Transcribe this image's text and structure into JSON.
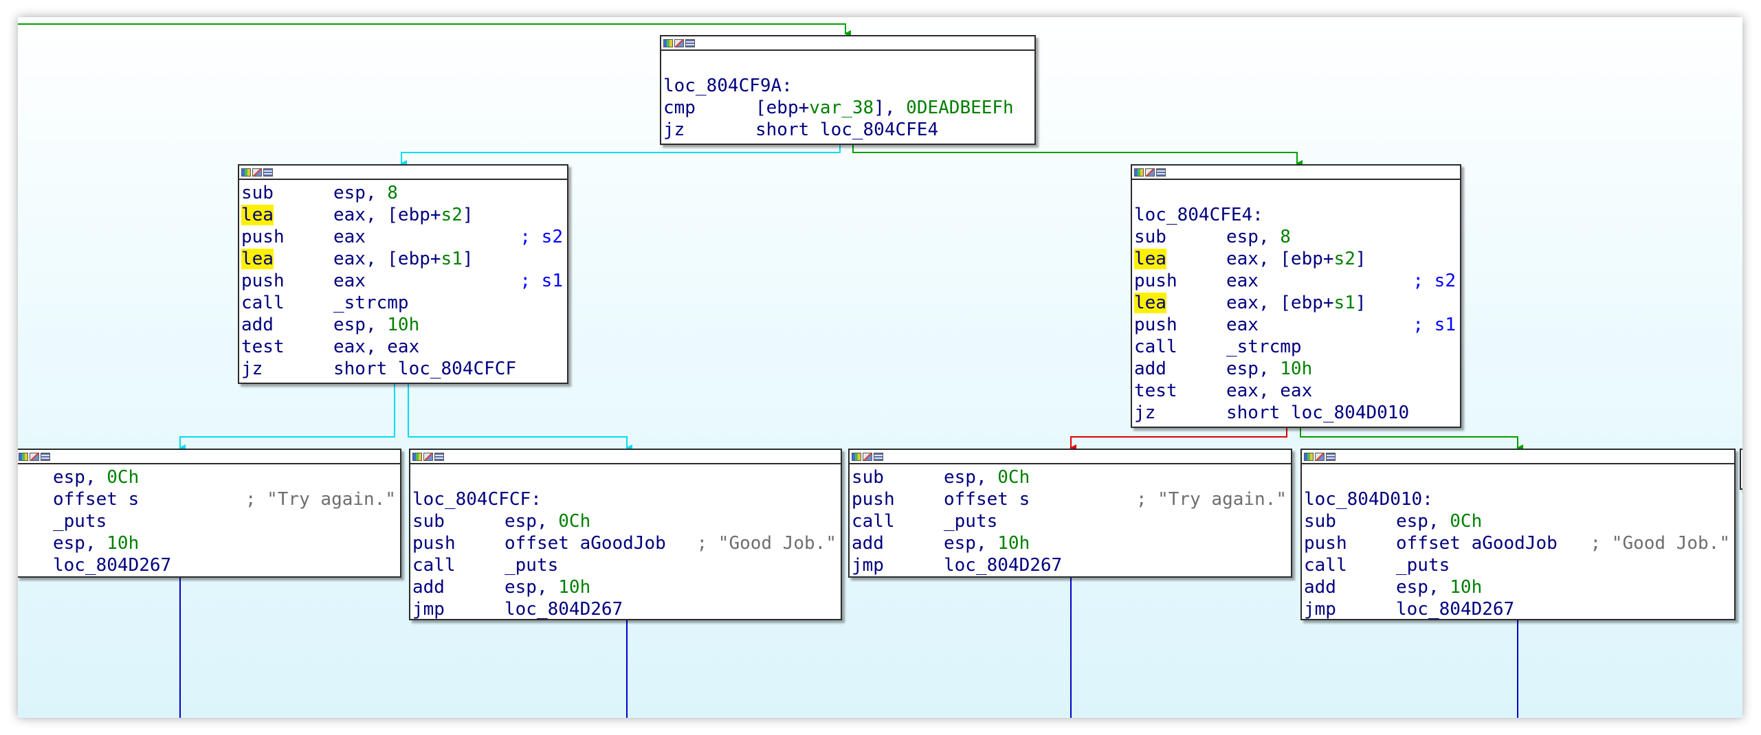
{
  "colors": {
    "edge_true": "#00a000",
    "edge_false": "#e00000",
    "edge_uncond": "#00dcf2",
    "edge_jump": "#0000cc",
    "mnemonic": "#00007f",
    "number": "#007f00",
    "string": "#6e6e6e",
    "highlight": "#fff000"
  },
  "blocks": {
    "b_cf9a": {
      "label": "loc_804CF9A:",
      "lines": [
        {
          "mn": "cmp",
          "op": "[ebp+var_38], 0DEADBEEFh",
          "cm": ""
        },
        {
          "mn": "jz",
          "op": "short loc_804CFE4",
          "cm": ""
        }
      ]
    },
    "b_left": {
      "label": "",
      "lines": [
        {
          "mn": "sub",
          "op": "esp, 8",
          "cm": ""
        },
        {
          "mn": "lea",
          "op": "eax, [ebp+s2]",
          "cm": ""
        },
        {
          "mn": "push",
          "op": "eax",
          "cm": "; s2"
        },
        {
          "mn": "lea",
          "op": "eax, [ebp+s1]",
          "cm": ""
        },
        {
          "mn": "push",
          "op": "eax",
          "cm": "; s1"
        },
        {
          "mn": "call",
          "op": "_strcmp",
          "cm": ""
        },
        {
          "mn": "add",
          "op": "esp, 10h",
          "cm": ""
        },
        {
          "mn": "test",
          "op": "eax, eax",
          "cm": ""
        },
        {
          "mn": "jz",
          "op": "short loc_804CFCF",
          "cm": ""
        }
      ]
    },
    "b_cfe4": {
      "label": "loc_804CFE4:",
      "lines": [
        {
          "mn": "sub",
          "op": "esp, 8",
          "cm": ""
        },
        {
          "mn": "lea",
          "op": "eax, [ebp+s2]",
          "cm": ""
        },
        {
          "mn": "push",
          "op": "eax",
          "cm": "; s2"
        },
        {
          "mn": "lea",
          "op": "eax, [ebp+s1]",
          "cm": ""
        },
        {
          "mn": "push",
          "op": "eax",
          "cm": "; s1"
        },
        {
          "mn": "call",
          "op": "_strcmp",
          "cm": ""
        },
        {
          "mn": "add",
          "op": "esp, 10h",
          "cm": ""
        },
        {
          "mn": "test",
          "op": "eax, eax",
          "cm": ""
        },
        {
          "mn": "jz",
          "op": "short loc_804D010",
          "cm": ""
        }
      ]
    },
    "b_try1": {
      "label": "",
      "lines": [
        {
          "mn": "",
          "op": "esp, 0Ch",
          "cm": ""
        },
        {
          "mn": "",
          "op": "offset s",
          "cm": "; \"Try again.\""
        },
        {
          "mn": "",
          "op": "_puts",
          "cm": ""
        },
        {
          "mn": "",
          "op": "esp, 10h",
          "cm": ""
        },
        {
          "mn": "",
          "op": "loc_804D267",
          "cm": ""
        }
      ]
    },
    "b_cfcf": {
      "label": "loc_804CFCF:",
      "lines": [
        {
          "mn": "sub",
          "op": "esp, 0Ch",
          "cm": ""
        },
        {
          "mn": "push",
          "op": "offset aGoodJob",
          "cm": "; \"Good Job.\""
        },
        {
          "mn": "call",
          "op": "_puts",
          "cm": ""
        },
        {
          "mn": "add",
          "op": "esp, 10h",
          "cm": ""
        },
        {
          "mn": "jmp",
          "op": "loc_804D267",
          "cm": ""
        }
      ]
    },
    "b_try2": {
      "label": "",
      "lines": [
        {
          "mn": "sub",
          "op": "esp, 0Ch",
          "cm": ""
        },
        {
          "mn": "push",
          "op": "offset s",
          "cm": "; \"Try again.\""
        },
        {
          "mn": "call",
          "op": "_puts",
          "cm": ""
        },
        {
          "mn": "add",
          "op": "esp, 10h",
          "cm": ""
        },
        {
          "mn": "jmp",
          "op": "loc_804D267",
          "cm": ""
        }
      ]
    },
    "b_d010": {
      "label": "loc_804D010:",
      "lines": [
        {
          "mn": "sub",
          "op": "esp, 0Ch",
          "cm": ""
        },
        {
          "mn": "push",
          "op": "offset aGoodJob",
          "cm": "; \"Good Job.\""
        },
        {
          "mn": "call",
          "op": "_puts",
          "cm": ""
        },
        {
          "mn": "add",
          "op": "esp, 10h",
          "cm": ""
        },
        {
          "mn": "jmp",
          "op": "loc_804D267",
          "cm": ""
        }
      ]
    }
  }
}
